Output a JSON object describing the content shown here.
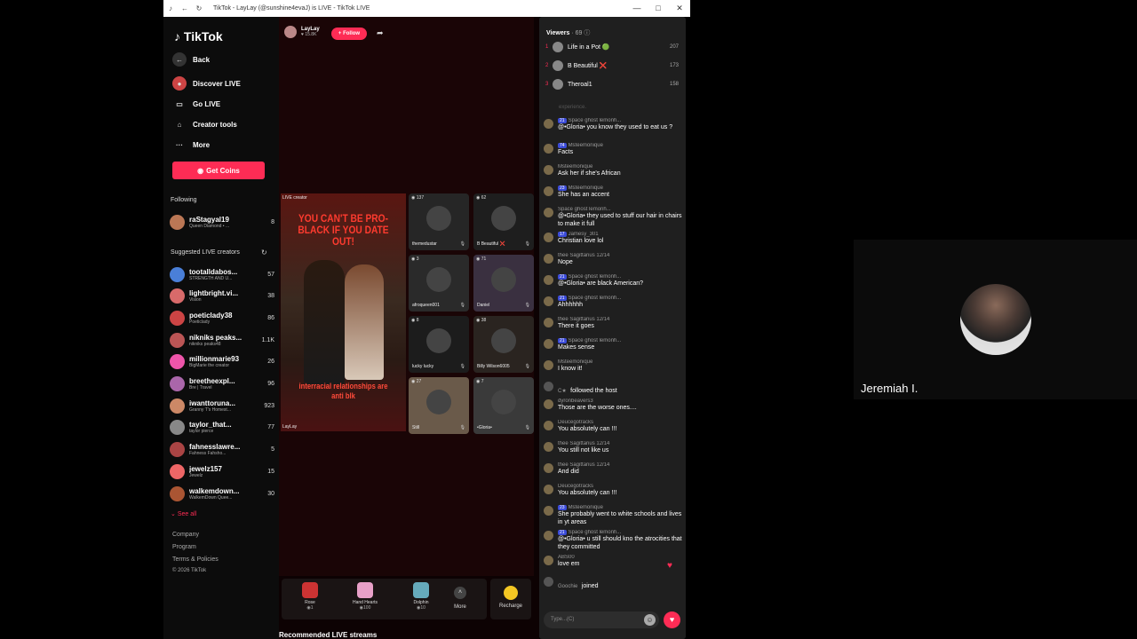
{
  "browser": {
    "title": "TikTok - LayLay (@sunshine4evaJ) is LIVE - TikTok LIVE",
    "controls": [
      "—",
      "□",
      "✕"
    ]
  },
  "sidebar": {
    "logo": "TikTok",
    "nav": [
      {
        "label": "Back",
        "icon": "arrow-left-icon"
      },
      {
        "label": "Discover LIVE",
        "icon": "live-avatar-icon"
      },
      {
        "label": "Go LIVE",
        "icon": "camera-icon"
      },
      {
        "label": "Creator tools",
        "icon": "home-icon"
      },
      {
        "label": "More",
        "icon": "dots-icon"
      }
    ],
    "coins_label": "Get Coins",
    "following_label": "Following",
    "following": [
      {
        "name": "raStagyal19",
        "sub": "Queen Diamond • ...",
        "count": "8"
      }
    ],
    "suggested_label": "Suggested LIVE creators",
    "suggested": [
      {
        "name": "tootalldabos...",
        "sub": "STRENGTH AND U...",
        "count": "57"
      },
      {
        "name": "lightbright.vi...",
        "sub": "Vision",
        "count": "38"
      },
      {
        "name": "poeticlady38",
        "sub": "Poeticlady",
        "count": "86"
      },
      {
        "name": "nikniks peaks...",
        "sub": "nikniks peaks48",
        "count": "1.1K"
      },
      {
        "name": "millionmarie93",
        "sub": "BigMarie the creator",
        "count": "26"
      },
      {
        "name": "breetheexpl...",
        "sub": "Bre | Travel",
        "count": "96"
      },
      {
        "name": "iwanttoruna...",
        "sub": "Granny T's Homest...",
        "count": "923"
      },
      {
        "name": "taylor_that...",
        "sub": "taylor pierce",
        "count": "77"
      },
      {
        "name": "fahnesslawre...",
        "sub": "Fahness Fahsho...",
        "count": "5"
      },
      {
        "name": "jewelz157",
        "sub": "Jewelz",
        "count": "15"
      },
      {
        "name": "walkemdown...",
        "sub": "WalkemDown Quee...",
        "count": "30"
      }
    ],
    "see_all": "See all",
    "footer": [
      "Company",
      "Program",
      "Terms & Policies",
      "© 2026 TikTok"
    ]
  },
  "stream": {
    "host_name": "LayLay",
    "host_likes": "15.8K",
    "follow_label": "+ Follow",
    "poster_tag": "LIVE creator",
    "poster_title": "YOU CAN'T BE PRO-BLACK IF YOU DATE OUT!",
    "poster_caption": "interracial relationships are anti blk",
    "poster_label": "LayLay",
    "tiles": [
      {
        "count": "137",
        "name": "themedustar"
      },
      {
        "count": "62",
        "name": "B Beautiful ❌"
      },
      {
        "count": "3",
        "name": "afroqueen001"
      },
      {
        "count": "71",
        "name": "Daniel"
      },
      {
        "count": "8",
        "name": "lucky lucky"
      },
      {
        "count": "38",
        "name": "Billy Wilson6005"
      },
      {
        "count": "27",
        "name": "Still"
      },
      {
        "count": "7",
        "name": "•Gloria•"
      }
    ],
    "gifts": [
      {
        "name": "Rose",
        "price": "1"
      },
      {
        "name": "Hand Hearts",
        "price": "100"
      },
      {
        "name": "Dolphin",
        "price": "10"
      }
    ],
    "more_label": "More",
    "recharge_label": "Recharge",
    "recommended_label": "Recommended LIVE streams"
  },
  "chat": {
    "viewers_label": "Viewers",
    "viewers_count": "· 69",
    "top_viewers": [
      {
        "rank": "1",
        "name": "Life in a Pot 🟢",
        "score": "207"
      },
      {
        "rank": "2",
        "name": "B Beautiful ❌",
        "score": "173"
      },
      {
        "rank": "3",
        "name": "Theroal1",
        "score": "158"
      }
    ],
    "faded": "experience.",
    "messages": [
      {
        "badge": "21",
        "user": "Space ghost lemonh...",
        "text": "@•Gloria• you know they used to eat us ?"
      },
      {
        "badge": "74",
        "user": "Msteemonique",
        "text": "Facts"
      },
      {
        "badge": "",
        "user": "Msteemonique",
        "text": "Ask her if she's African"
      },
      {
        "badge": "23",
        "user": "Msteemonique",
        "text": "She has an accent"
      },
      {
        "badge": "",
        "user": "Space ghost lemonh...",
        "text": "@•Gloria• they used to stuff our hair in chairs to make it full"
      },
      {
        "badge": "17",
        "user": "Jamesy_301",
        "text": "Christian love lol"
      },
      {
        "badge": "",
        "user": "thee Sagittarius 12/14",
        "text": "Nope"
      },
      {
        "badge": "21",
        "user": "Space ghost lemonh...",
        "text": "@•Gloria• are black American?"
      },
      {
        "badge": "21",
        "user": "Space ghost lemonh...",
        "text": "Ahhhhhh"
      },
      {
        "badge": "",
        "user": "thee Sagittarius 12/14",
        "text": "There it goes"
      },
      {
        "badge": "21",
        "user": "Space ghost lemonh...",
        "text": "Makes sense"
      },
      {
        "badge": "",
        "user": "Msteemonique",
        "text": "I know it!"
      },
      {
        "badge": "",
        "user": "C★",
        "text": "followed the host"
      },
      {
        "badge": "",
        "user": "dyronbeavers3",
        "text": "Those are the worse ones...."
      },
      {
        "badge": "",
        "user": "Deucegotracks",
        "text": "You absolutely can !!!"
      },
      {
        "badge": "",
        "user": "thee Sagittarius 12/14",
        "text": "You still not like us"
      },
      {
        "badge": "",
        "user": "thee Sagittarius 12/14",
        "text": "And did"
      },
      {
        "badge": "",
        "user": "Deucegotracks",
        "text": "You absolutely can !!!"
      },
      {
        "badge": "23",
        "user": "Msteemonique",
        "text": "She probably went to white schools and lives in yt areas"
      },
      {
        "badge": "21",
        "user": "Space ghost lemonh...",
        "text": "@•Gloria• u still should kno the atrocities that they committed"
      },
      {
        "badge": "",
        "user": "ABS00",
        "text": "love em"
      },
      {
        "badge": "",
        "user": "Goochie",
        "text": "joined"
      }
    ],
    "input_placeholder": "Type...(C)"
  },
  "participant": {
    "name": "Jeremiah I."
  }
}
